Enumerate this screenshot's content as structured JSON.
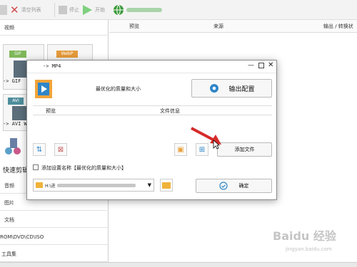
{
  "toolbar": {
    "clear_list": "清空列表",
    "stop": "停止",
    "start": "开始"
  },
  "sidebar": {
    "video_header": "视频",
    "to_gif": "-> GIF",
    "to_avi": "-> AVI W",
    "quick_clip": "快速剪辑",
    "audio": "音频",
    "image": "图片",
    "document": "文档",
    "dvd": "ROM\\DVD\\CD\\ISO",
    "toolbox": "工具集"
  },
  "main_list": {
    "col_preview": "预览",
    "col_source": "来源",
    "col_output": "输出 / 转换状"
  },
  "dialog": {
    "title": "-> MP4",
    "quality": "最优化的质量和大小",
    "output_config": "输出配置",
    "col_preview": "预览",
    "col_fileinfo": "文件信息",
    "add_file": "添加文件",
    "append_label": "添加设置名称【最优化的质量和大小】",
    "path": "H:\\进",
    "ok": "确定"
  },
  "watermark": "Baidu 经验",
  "watermark_url": "jingyan.baidu.com"
}
